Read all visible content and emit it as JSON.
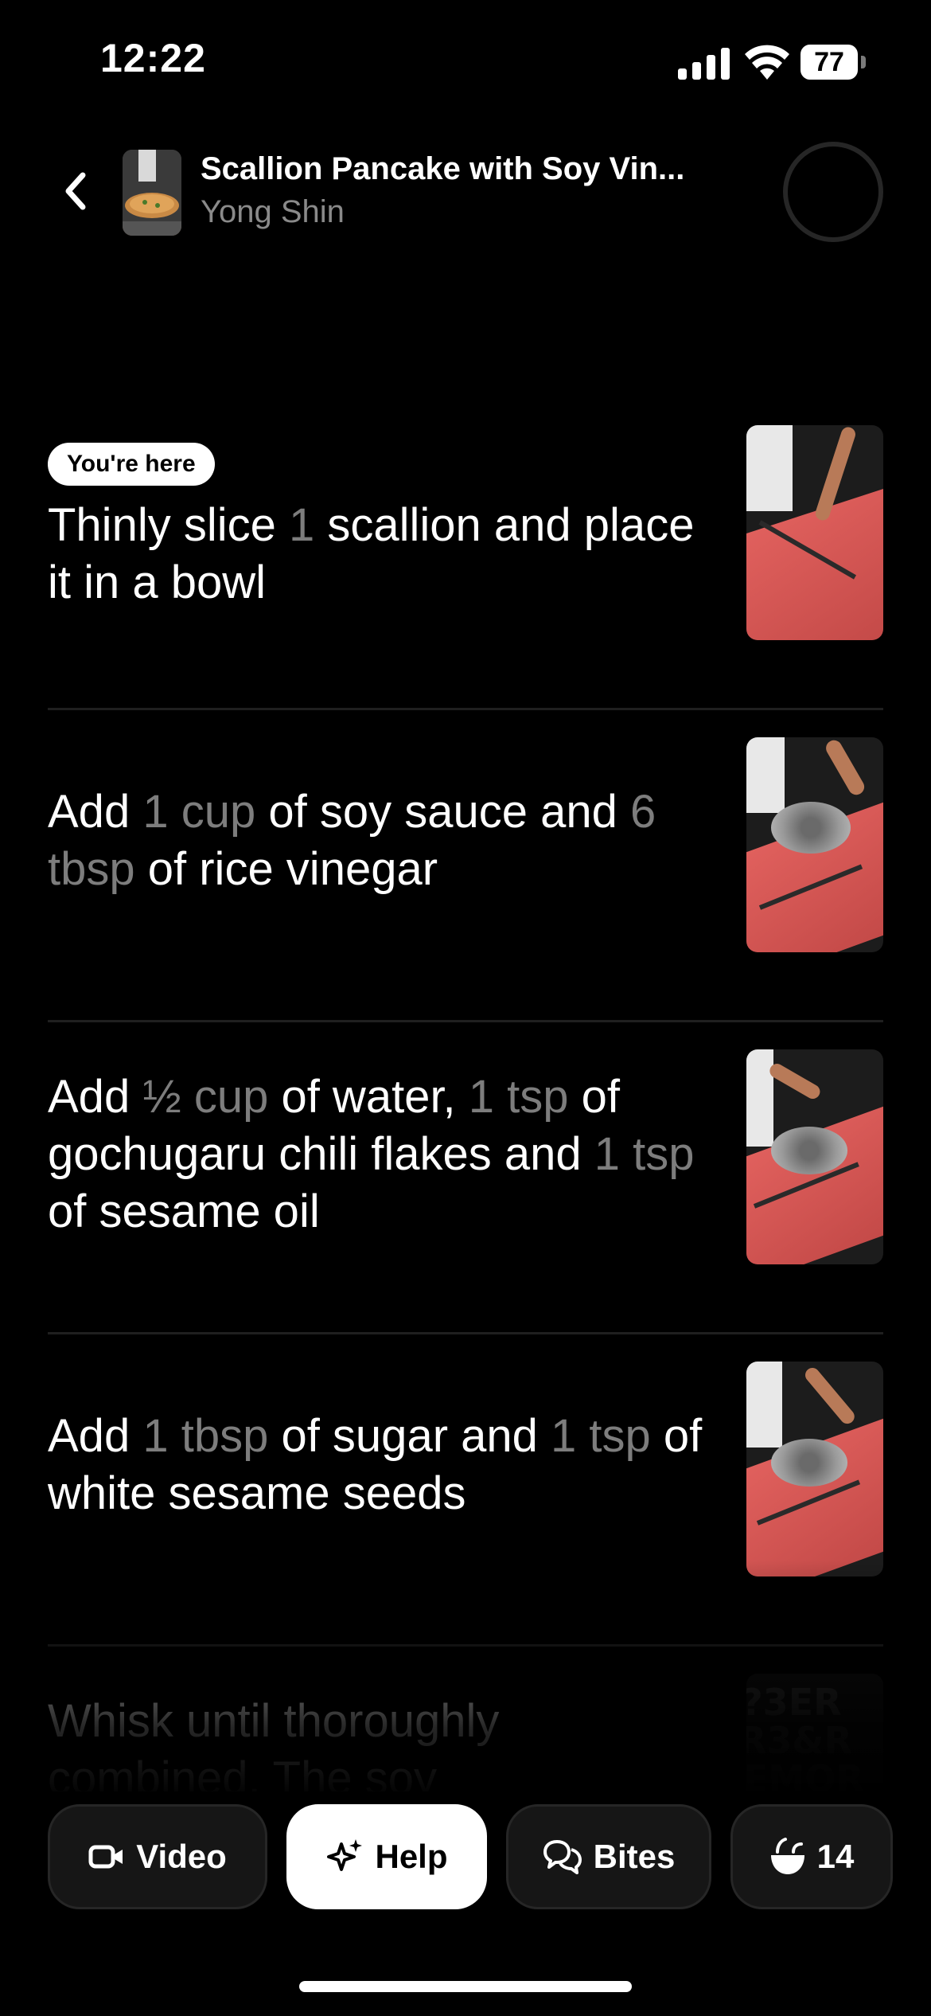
{
  "status_bar": {
    "time": "12:22",
    "battery": "77"
  },
  "header": {
    "title": "Scallion Pancake with Soy Vin...",
    "author": "Yong Shin"
  },
  "steps": [
    {
      "badge": "You're here",
      "parts": [
        {
          "t": "Thinly slice ",
          "q": false
        },
        {
          "t": "1",
          "q": true
        },
        {
          "t": " scallion and place it in a bowl",
          "q": false
        }
      ]
    },
    {
      "parts": [
        {
          "t": "Add ",
          "q": false
        },
        {
          "t": "1 cup",
          "q": true
        },
        {
          "t": " of soy sauce and ",
          "q": false
        },
        {
          "t": "6 tbsp",
          "q": true
        },
        {
          "t": " of rice vinegar",
          "q": false
        }
      ]
    },
    {
      "parts": [
        {
          "t": "Add ",
          "q": false
        },
        {
          "t": "½ cup",
          "q": true
        },
        {
          "t": " of water, ",
          "q": false
        },
        {
          "t": "1 tsp",
          "q": true
        },
        {
          "t": " of gochugaru chili flakes and ",
          "q": false
        },
        {
          "t": "1 tsp",
          "q": true
        },
        {
          "t": " of sesame oil",
          "q": false
        }
      ]
    },
    {
      "parts": [
        {
          "t": "Add ",
          "q": false
        },
        {
          "t": "1 tbsp",
          "q": true
        },
        {
          "t": " of sugar and ",
          "q": false
        },
        {
          "t": "1 tsp",
          "q": true
        },
        {
          "t": " of white sesame seeds",
          "q": false
        }
      ]
    },
    {
      "parts": [
        {
          "t": "Whisk until thoroughly combined. The soy",
          "q": false
        }
      ]
    }
  ],
  "toolbar": {
    "video_label": "Video",
    "help_label": "Help",
    "bites_label": "Bites",
    "servings": "14"
  },
  "colors": {
    "background": "#000000",
    "quantity_text": "#7d7d7d",
    "cutting_board": "#d85654",
    "button_bg": "#161616"
  }
}
